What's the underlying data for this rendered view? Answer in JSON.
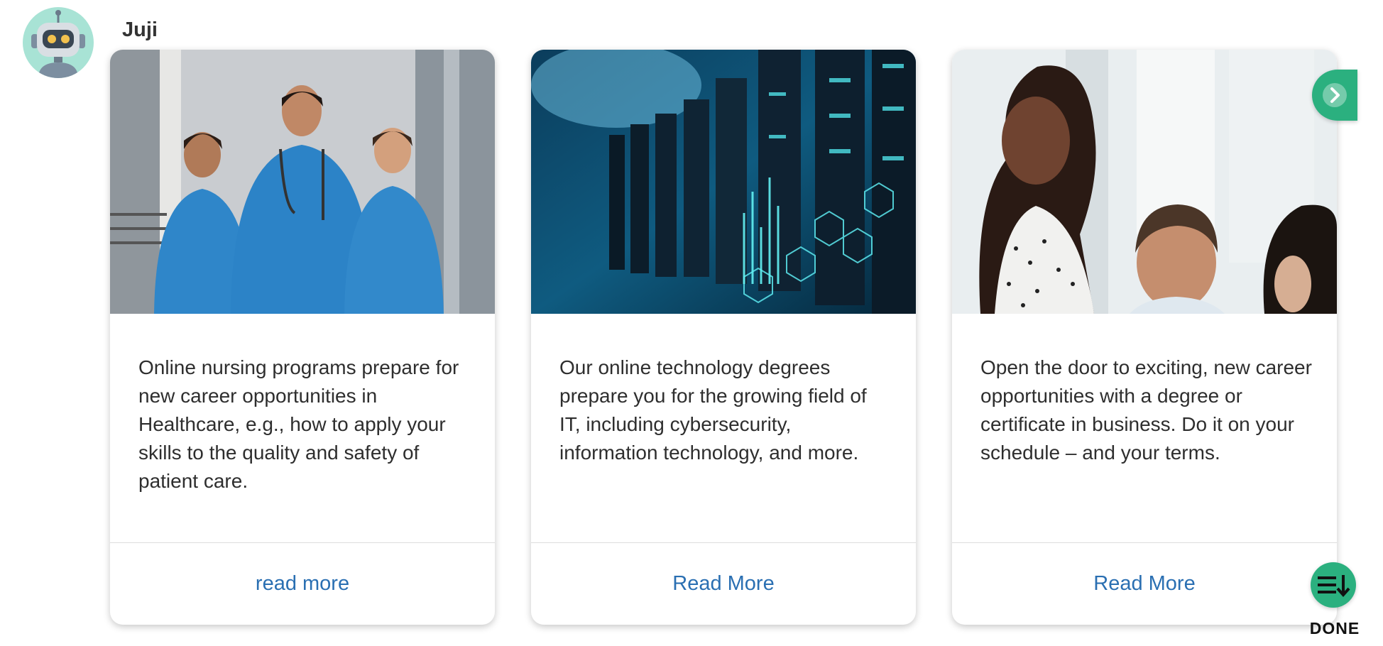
{
  "bot": {
    "name": "Juji",
    "avatar_icon": "robot-icon"
  },
  "cards": [
    {
      "image_icon": "nurses-photo",
      "text": "Online nursing programs prepare for new career opportunities in Healthcare, e.g., how to apply your skills to the quality and safety of patient care.",
      "link_label": "read more"
    },
    {
      "image_icon": "server-technology-photo",
      "text": "Our online technology degrees prepare you for the growing field of IT, including cybersecurity, information technology, and more.",
      "link_label": "Read More"
    },
    {
      "image_icon": "business-people-photo",
      "text": "Open the door to exciting, new career opportunities with a degree or certificate in business. Do it on your schedule – and your terms.",
      "link_label": "Read More"
    }
  ],
  "controls": {
    "next_icon": "chevron-right-circle-icon",
    "done_icon": "list-down-arrow-icon",
    "done_label": "DONE"
  },
  "colors": {
    "accent": "#2bb07f",
    "link": "#2a6fb2",
    "avatar_bg": "#a8e3d5"
  }
}
